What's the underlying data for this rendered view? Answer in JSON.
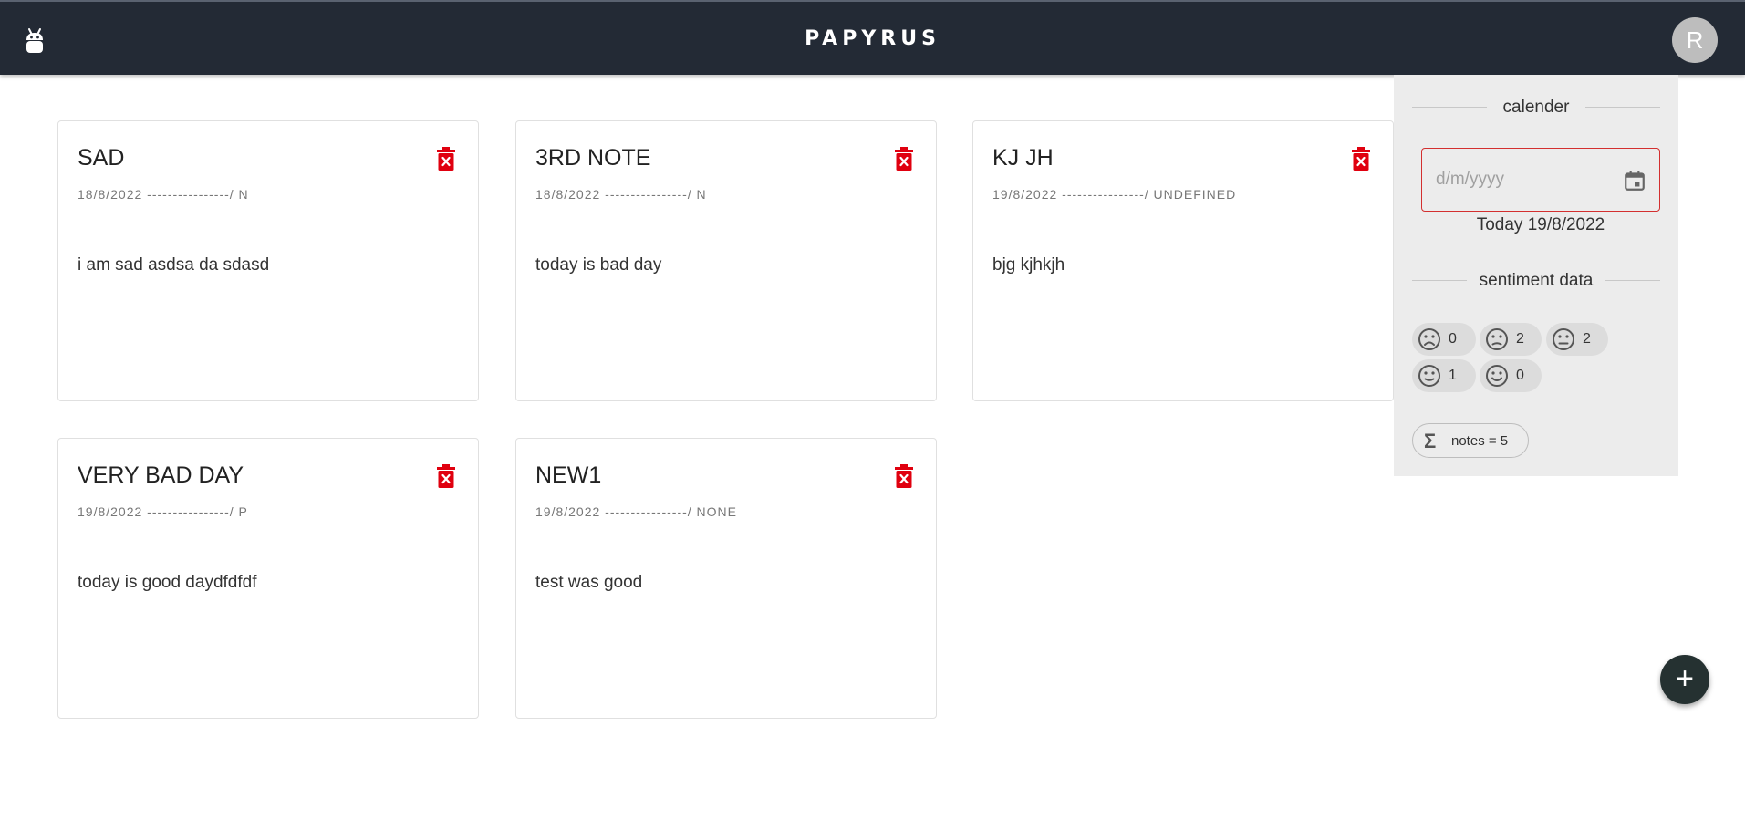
{
  "appbar": {
    "brand": "PAPYRUS",
    "avatar_letter": "R"
  },
  "notes": [
    {
      "title": "SAD",
      "meta": "18/8/2022 ----------------/ N",
      "body": "i am sad asdsa da sdasd"
    },
    {
      "title": "3RD NOTE",
      "meta": "18/8/2022 ----------------/ N",
      "body": "today is bad day"
    },
    {
      "title": "KJ JH",
      "meta": "19/8/2022 ----------------/ UNDEFINED",
      "body": "bjg kjhkjh"
    },
    {
      "title": "VERY BAD DAY",
      "meta": "19/8/2022 ----------------/ P",
      "body": "today is good daydfdfdf"
    },
    {
      "title": "NEW1",
      "meta": "19/8/2022 ----------------/ NONE",
      "body": "test was good"
    }
  ],
  "sidebar": {
    "calendar_heading": "calender",
    "date_placeholder": "d/m/yyyy",
    "today_text": "Today 19/8/2022",
    "sentiment_heading": "sentiment data",
    "sentiments": [
      {
        "icon": "very-sad-face-icon",
        "count": "0"
      },
      {
        "icon": "sad-face-icon",
        "count": "2"
      },
      {
        "icon": "neutral-face-icon",
        "count": "2"
      },
      {
        "icon": "slightly-happy-face-icon",
        "count": "1"
      },
      {
        "icon": "happy-face-icon",
        "count": "0"
      }
    ],
    "notes_total": "notes = 5"
  },
  "fab": {
    "label": "+"
  },
  "colors": {
    "appbar": "#232a35",
    "delete": "#e0000f",
    "sidebar": "#ececec",
    "fab": "#253131",
    "field_border": "#d32f2f"
  }
}
